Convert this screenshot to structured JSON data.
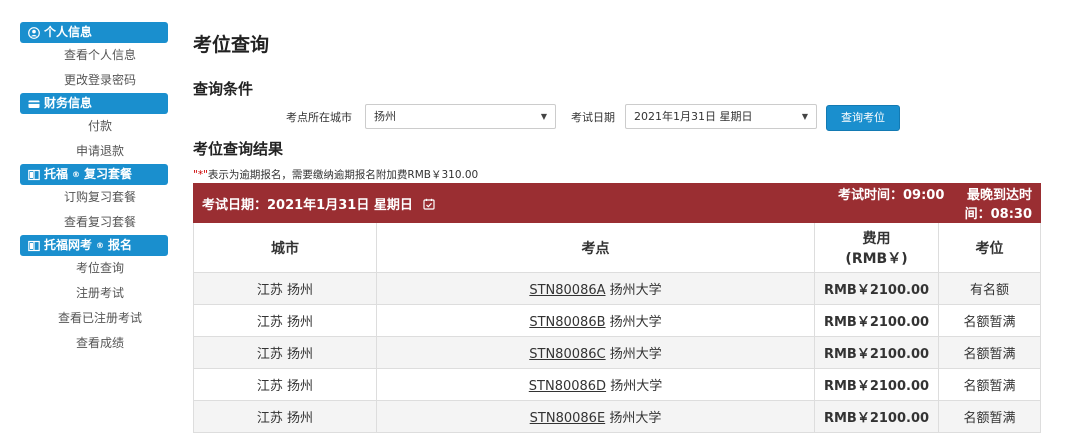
{
  "sidebar": {
    "sections": [
      {
        "title": "个人信息",
        "items": [
          "查看个人信息",
          "更改登录密码"
        ]
      },
      {
        "title": "财务信息",
        "items": [
          "付款",
          "申请退款"
        ]
      },
      {
        "title_prefix": "托福",
        "title_suffix": "复习套餐",
        "items": [
          "订购复习套餐",
          "查看复习套餐"
        ]
      },
      {
        "title_prefix": "托福网考",
        "title_suffix": "报名",
        "items": [
          "考位查询",
          "注册考试",
          "查看已注册考试",
          "查看成绩"
        ]
      }
    ],
    "registered_mark": "®"
  },
  "page": {
    "title": "考位查询",
    "conditions_title": "查询条件",
    "city_label": "考点所在城市",
    "city_value": "扬州",
    "date_label": "考试日期",
    "date_value": "2021年1月31日 星期日",
    "query_button": "查询考位",
    "results_title": "考位查询结果",
    "note_mark": "\"*\"",
    "note_text": "表示为逾期报名，需要缴纳逾期报名附加费RMB￥310.00"
  },
  "table": {
    "banner_date": "考试日期：2021年1月31日 星期日",
    "banner_time": "考试时间：09:00",
    "banner_arrival": "最晚到达时间：08:30",
    "headers": {
      "city": "城市",
      "center": "考点",
      "fee_line1": "费用",
      "fee_line2": "(RMB￥)",
      "seat": "考位"
    },
    "rows": [
      {
        "city": "江苏 扬州",
        "code": "STN80086A",
        "name": "扬州大学",
        "fee": "RMB￥2100.00",
        "seat": "有名额"
      },
      {
        "city": "江苏 扬州",
        "code": "STN80086B",
        "name": "扬州大学",
        "fee": "RMB￥2100.00",
        "seat": "名额暂满"
      },
      {
        "city": "江苏 扬州",
        "code": "STN80086C",
        "name": "扬州大学",
        "fee": "RMB￥2100.00",
        "seat": "名额暂满"
      },
      {
        "city": "江苏 扬州",
        "code": "STN80086D",
        "name": "扬州大学",
        "fee": "RMB￥2100.00",
        "seat": "名额暂满"
      },
      {
        "city": "江苏 扬州",
        "code": "STN80086E",
        "name": "扬州大学",
        "fee": "RMB￥2100.00",
        "seat": "名额暂满"
      }
    ]
  },
  "colors": {
    "accent": "#1a8fce",
    "banner": "#9a2e32"
  },
  "icons": [
    "user-circle-icon",
    "card-icon",
    "book-icon",
    "book-icon",
    "calendar-check-icon"
  ]
}
